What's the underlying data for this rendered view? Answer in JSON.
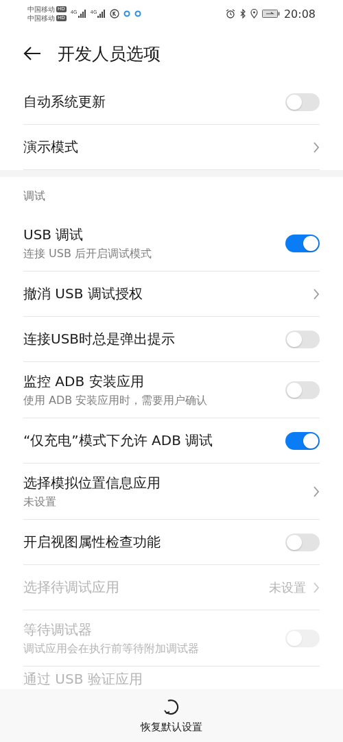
{
  "status_bar": {
    "carriers": [
      {
        "name": "中国移动",
        "badge": "HD"
      },
      {
        "name": "中国移动",
        "badge": "HD"
      }
    ],
    "signals": [
      {
        "network": "4G"
      },
      {
        "network": "4G"
      }
    ],
    "time": "20:08"
  },
  "header": {
    "title": "开发人员选项"
  },
  "sections": [
    {
      "rows": [
        {
          "kind": "toggle",
          "title": "自动系统更新",
          "on": false,
          "disabled": false
        },
        {
          "kind": "link",
          "title": "演示模式",
          "disabled": false
        }
      ]
    },
    {
      "header": "调试",
      "rows": [
        {
          "kind": "toggle",
          "title": "USB 调试",
          "subtitle": "连接 USB 后开启调试模式",
          "on": true,
          "disabled": false
        },
        {
          "kind": "link",
          "title": "撤消 USB 调试授权",
          "disabled": false
        },
        {
          "kind": "toggle",
          "title": "连接USB时总是弹出提示",
          "on": false,
          "disabled": false
        },
        {
          "kind": "toggle",
          "title": "监控 ADB 安装应用",
          "subtitle": "使用 ADB 安装应用时，需要用户确认",
          "on": false,
          "disabled": false
        },
        {
          "kind": "toggle",
          "title": "“仅充电”模式下允许 ADB 调试",
          "on": true,
          "disabled": false
        },
        {
          "kind": "link",
          "title": "选择模拟位置信息应用",
          "subtitle": "未设置",
          "disabled": false
        },
        {
          "kind": "toggle",
          "title": "开启视图属性检查功能",
          "on": false,
          "disabled": false
        },
        {
          "kind": "link",
          "title": "选择待调试应用",
          "value": "未设置",
          "disabled": true
        },
        {
          "kind": "toggle",
          "title": "等待调试器",
          "subtitle": "调试应用会在执行前等待附加调试器",
          "on": false,
          "disabled": true
        },
        {
          "kind": "plain",
          "title": "通过 USB 验证应用",
          "disabled": true
        }
      ]
    }
  ],
  "bottom_action": {
    "label": "恢复默认设置"
  }
}
